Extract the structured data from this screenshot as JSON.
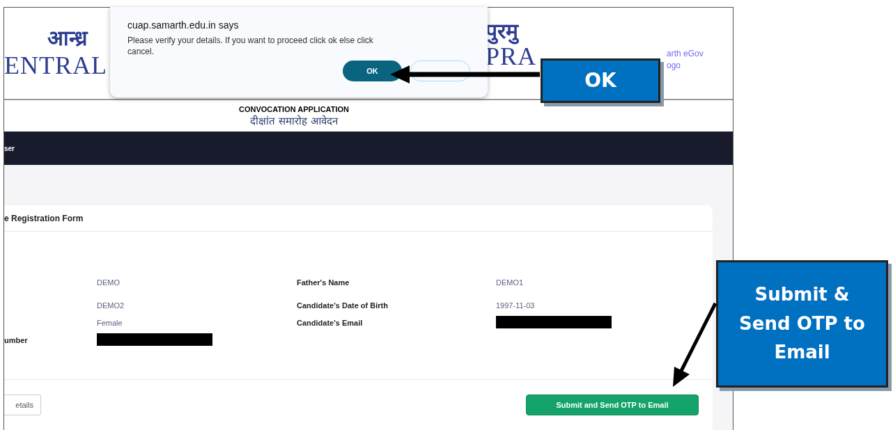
{
  "header": {
    "hindi_left": "आन्ध्र",
    "english_left": "ENTRAL",
    "hindi_right": "पुरमु",
    "english_right": "PRA",
    "logo_caption": [
      "arth eGov",
      "ogo"
    ]
  },
  "page_title": {
    "english": "CONVOCATION APPLICATION",
    "hindi": "दीक्षांत समारोह आवेदन"
  },
  "nav": {
    "item": "ser"
  },
  "form": {
    "title": "e Registration Form",
    "rows": [
      {
        "left": {
          "value": "DEMO",
          "kind": "text"
        },
        "right": {
          "label": "Father's Name",
          "value": "DEMO1",
          "kind": "text"
        }
      },
      {
        "left": {
          "value": "DEMO2",
          "kind": "text"
        },
        "right": {
          "label": "Candidate's Date of Birth",
          "value": "1997-11-03",
          "kind": "text"
        }
      },
      {
        "left": {
          "value": "Female",
          "kind": "text"
        },
        "right": {
          "label": "Candidate's Email",
          "kind": "redacted"
        }
      },
      {
        "left": {
          "label": "umber",
          "kind": "redacted"
        },
        "right": {
          "kind": "text"
        }
      }
    ],
    "back_button": "etails",
    "submit_button": "Submit and Send OTP to Email"
  },
  "dialog": {
    "title": "cuap.samarth.edu.in says",
    "message": "Please verify your details. If you want to proceed click ok else click cancel.",
    "ok_button": "OK"
  },
  "callouts": [
    {
      "text": "OK"
    },
    {
      "text": "Submit & Send OTP to Email"
    }
  ]
}
